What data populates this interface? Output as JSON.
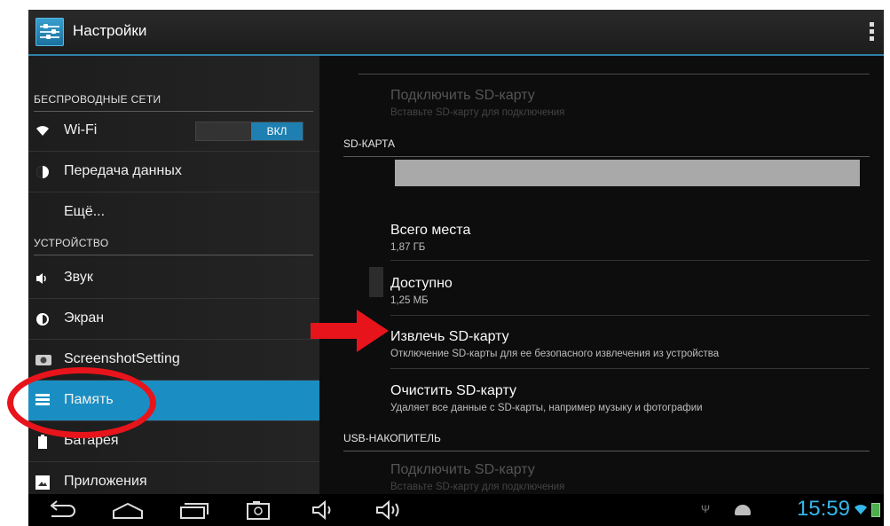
{
  "app": {
    "title": "Настройки"
  },
  "left": {
    "headers": {
      "wireless": "БЕСПРОВОДНЫЕ СЕТИ",
      "device": "УСТРОЙСТВО"
    },
    "items": {
      "wifi": "Wi-Fi",
      "wifi_toggle": "ВКЛ",
      "data": "Передача данных",
      "more": "Ещё...",
      "sound": "Звук",
      "screen": "Экран",
      "screenshot": "ScreenshotSetting",
      "memory": "Память",
      "battery": "Батарея",
      "apps": "Приложения"
    }
  },
  "right": {
    "mount_top": {
      "title": "Подключить SD-карту",
      "sub": "Вставьте SD-карту для подключения"
    },
    "section_sd": "SD-КАРТА",
    "total": {
      "title": "Всего места",
      "value": "1,87 ГБ"
    },
    "available": {
      "title": "Доступно",
      "value": "1,25 МБ"
    },
    "eject": {
      "title": "Извлечь SD-карту",
      "sub": "Отключение SD-карты для ее безопасного извлечения из устройства"
    },
    "format": {
      "title": "Очистить SD-карту",
      "sub": "Удаляет все данные с SD-карты, например музыку и фотографии"
    },
    "section_usb": "USB-НАКОПИТЕЛЬ",
    "mount_bottom": {
      "title": "Подключить SD-карту",
      "sub": "Вставьте SD-карту для подключения"
    }
  },
  "status": {
    "time": "15:59"
  },
  "colors": {
    "accent": "#1a8ec2",
    "clock": "#35b6e8",
    "annotation": "#e8141b"
  }
}
